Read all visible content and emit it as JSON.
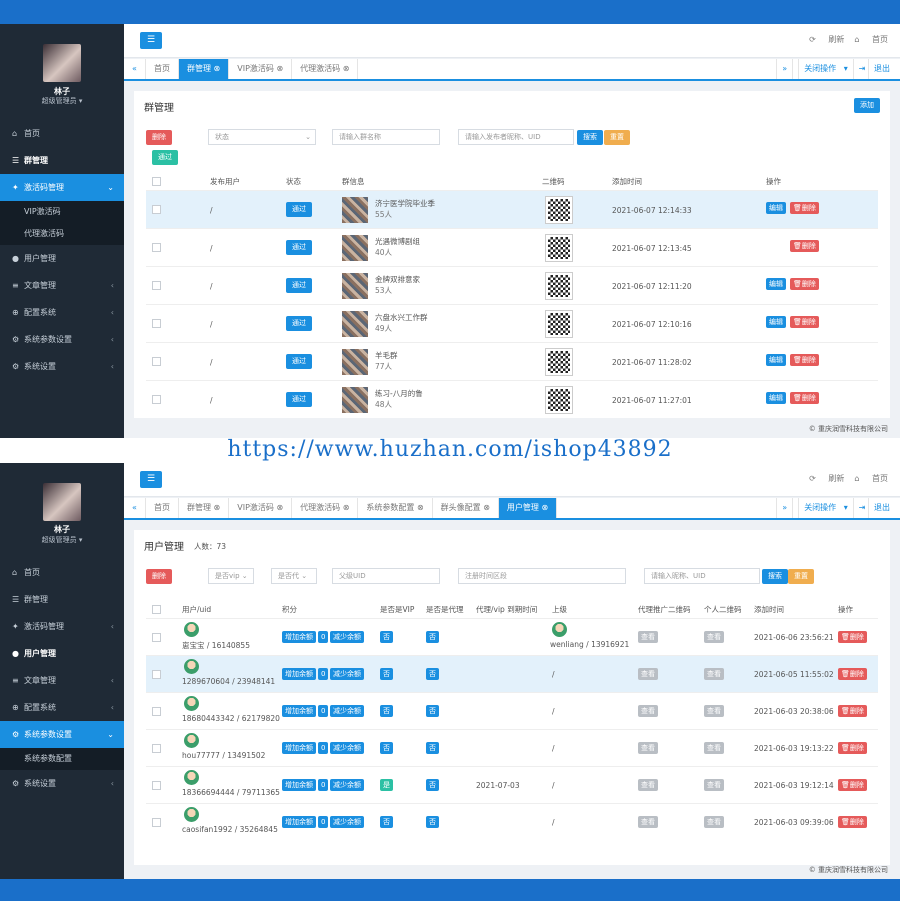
{
  "app": {
    "user_name": "林子",
    "user_role": "超级管理员",
    "refresh": "刷新",
    "home": "首页",
    "close_ops": "关闭操作",
    "logout": "退出",
    "toggle_icon": "menu-icon"
  },
  "watermark": "https://www.huzhan.com/ishop43892",
  "panel1": {
    "menu": [
      {
        "label": "首页",
        "icon": "⌂"
      },
      {
        "label": "群管理",
        "icon": "☰"
      },
      {
        "label": "激活码管理",
        "icon": "✦"
      }
    ],
    "submenu": [
      "VIP激活码",
      "代理激活码"
    ],
    "menu_after": [
      {
        "label": "用户管理",
        "icon": "●"
      },
      {
        "label": "文章管理",
        "icon": "≡"
      },
      {
        "label": "配置系统",
        "icon": "⊕"
      },
      {
        "label": "系统参数设置",
        "icon": "⚙"
      },
      {
        "label": "系统设置",
        "icon": "⚙"
      }
    ],
    "tabs": [
      "首页",
      "群管理",
      "VIP激活码",
      "代理激活码"
    ],
    "title": "群管理",
    "add_btn": "添加",
    "delete_btn": "删除",
    "status_select": "状态",
    "group_name_placeholder": "请输入群名称",
    "publisher_placeholder": "请输入发布者昵称、UID",
    "search_btn": "搜索",
    "reset_btn": "重置",
    "pass_btn": "通过",
    "headers": [
      "发布用户",
      "状态",
      "群信息",
      "二维码",
      "添加时间",
      "操作"
    ],
    "rows": [
      {
        "user": "/",
        "status": "通过",
        "name": "济宁医学院毕业季",
        "count": "55人",
        "time": "2021-06-07 12:14:33",
        "edit": true
      },
      {
        "user": "/",
        "status": "通过",
        "name": "光遇微博剧组",
        "count": "40人",
        "time": "2021-06-07 12:13:45",
        "edit": false
      },
      {
        "user": "/",
        "status": "通过",
        "name": "金牌双排意家",
        "count": "53人",
        "time": "2021-06-07 12:11:20",
        "edit": true
      },
      {
        "user": "/",
        "status": "通过",
        "name": "六盘水兴工作群",
        "count": "49人",
        "time": "2021-06-07 12:10:16",
        "edit": true
      },
      {
        "user": "/",
        "status": "通过",
        "name": "羊毛群",
        "count": "77人",
        "time": "2021-06-07 11:28:02",
        "edit": true
      },
      {
        "user": "/",
        "status": "通过",
        "name": "练习-八月的鲁",
        "count": "48人",
        "time": "2021-06-07 11:27:01",
        "edit": true
      }
    ],
    "edit_label": "编辑",
    "del_label": "删除",
    "footer": "© 重庆润雪科技有限公司"
  },
  "panel2": {
    "menu": [
      {
        "label": "首页",
        "icon": "⌂"
      },
      {
        "label": "群管理",
        "icon": "☰"
      },
      {
        "label": "激活码管理",
        "icon": "✦"
      },
      {
        "label": "用户管理",
        "icon": "●"
      },
      {
        "label": "文章管理",
        "icon": "≡"
      },
      {
        "label": "配置系统",
        "icon": "⊕"
      },
      {
        "label": "系统参数设置",
        "icon": "⚙"
      }
    ],
    "submenu": [
      "系统参数配置"
    ],
    "menu_after": [
      {
        "label": "系统设置",
        "icon": "⚙"
      }
    ],
    "tabs": [
      "首页",
      "群管理",
      "VIP激活码",
      "代理激活码",
      "系统参数配置",
      "群头像配置",
      "用户管理"
    ],
    "title": "用户管理",
    "count": "人数：73",
    "delete_btn": "删除",
    "vip_select": "是否vip",
    "agent_select": "是否代",
    "parent_placeholder": "父级UID",
    "time_placeholder": "注册时间区段",
    "nick_placeholder": "请输入昵称、UID",
    "search_btn": "搜索",
    "reset_btn": "重置",
    "headers": [
      "用户/uid",
      "积分",
      "是否是VIP",
      "是否是代理",
      "代理/vip 到期时间",
      "上级",
      "代理推广二维码",
      "个人二维码",
      "添加时间",
      "操作"
    ],
    "add_bal": "增加余额",
    "sub_bal": "减少余额",
    "no": "否",
    "yes": "是",
    "view": "查看",
    "del_label": "删除",
    "rows": [
      {
        "user": "崽宝宝 / 16140855",
        "points": "0",
        "vip": "否",
        "agent": "否",
        "expire": "",
        "parent_name": "wenliang / 13916921",
        "time": "2021-06-06 23:56:21"
      },
      {
        "user": "1289670604 / 23948141",
        "points": "0",
        "vip": "否",
        "agent": "否",
        "expire": "",
        "parent_name": "/",
        "time": "2021-06-05 11:55:02"
      },
      {
        "user": "18680443342 / 62179820",
        "points": "0",
        "vip": "否",
        "agent": "否",
        "expire": "",
        "parent_name": "/",
        "time": "2021-06-03 20:38:06"
      },
      {
        "user": "hou77777 / 13491502",
        "points": "0",
        "vip": "否",
        "agent": "否",
        "expire": "",
        "parent_name": "/",
        "time": "2021-06-03 19:13:22"
      },
      {
        "user": "18366694444 / 79711365",
        "points": "0",
        "vip": "是",
        "agent": "否",
        "expire": "2021-07-03",
        "parent_name": "/",
        "time": "2021-06-03 19:12:14"
      },
      {
        "user": "caosifan1992 / 35264845",
        "points": "0",
        "vip": "否",
        "agent": "否",
        "expire": "",
        "parent_name": "/",
        "time": "2021-06-03 09:39:06"
      }
    ],
    "footer": "© 重庆润雪科技有限公司"
  }
}
